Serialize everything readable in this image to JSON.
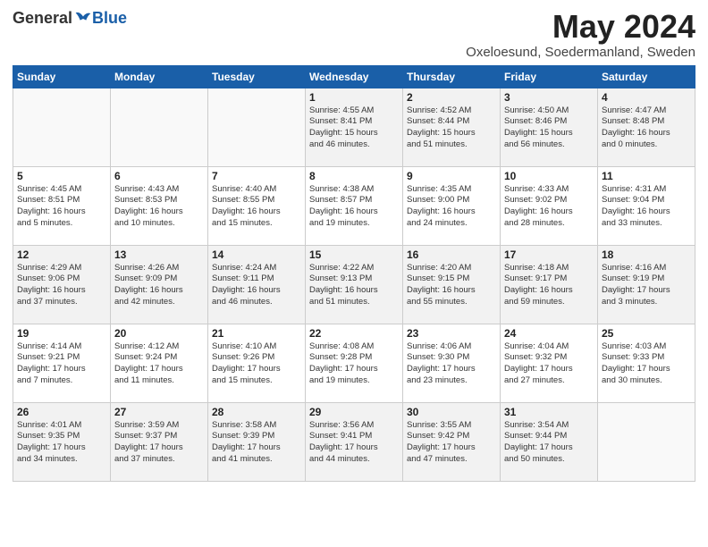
{
  "logo": {
    "general": "General",
    "blue": "Blue"
  },
  "title": "May 2024",
  "location": "Oxeloesund, Soedermanland, Sweden",
  "headers": [
    "Sunday",
    "Monday",
    "Tuesday",
    "Wednesday",
    "Thursday",
    "Friday",
    "Saturday"
  ],
  "weeks": [
    [
      {
        "num": "",
        "info": ""
      },
      {
        "num": "",
        "info": ""
      },
      {
        "num": "",
        "info": ""
      },
      {
        "num": "1",
        "info": "Sunrise: 4:55 AM\nSunset: 8:41 PM\nDaylight: 15 hours\nand 46 minutes."
      },
      {
        "num": "2",
        "info": "Sunrise: 4:52 AM\nSunset: 8:44 PM\nDaylight: 15 hours\nand 51 minutes."
      },
      {
        "num": "3",
        "info": "Sunrise: 4:50 AM\nSunset: 8:46 PM\nDaylight: 15 hours\nand 56 minutes."
      },
      {
        "num": "4",
        "info": "Sunrise: 4:47 AM\nSunset: 8:48 PM\nDaylight: 16 hours\nand 0 minutes."
      }
    ],
    [
      {
        "num": "5",
        "info": "Sunrise: 4:45 AM\nSunset: 8:51 PM\nDaylight: 16 hours\nand 5 minutes."
      },
      {
        "num": "6",
        "info": "Sunrise: 4:43 AM\nSunset: 8:53 PM\nDaylight: 16 hours\nand 10 minutes."
      },
      {
        "num": "7",
        "info": "Sunrise: 4:40 AM\nSunset: 8:55 PM\nDaylight: 16 hours\nand 15 minutes."
      },
      {
        "num": "8",
        "info": "Sunrise: 4:38 AM\nSunset: 8:57 PM\nDaylight: 16 hours\nand 19 minutes."
      },
      {
        "num": "9",
        "info": "Sunrise: 4:35 AM\nSunset: 9:00 PM\nDaylight: 16 hours\nand 24 minutes."
      },
      {
        "num": "10",
        "info": "Sunrise: 4:33 AM\nSunset: 9:02 PM\nDaylight: 16 hours\nand 28 minutes."
      },
      {
        "num": "11",
        "info": "Sunrise: 4:31 AM\nSunset: 9:04 PM\nDaylight: 16 hours\nand 33 minutes."
      }
    ],
    [
      {
        "num": "12",
        "info": "Sunrise: 4:29 AM\nSunset: 9:06 PM\nDaylight: 16 hours\nand 37 minutes."
      },
      {
        "num": "13",
        "info": "Sunrise: 4:26 AM\nSunset: 9:09 PM\nDaylight: 16 hours\nand 42 minutes."
      },
      {
        "num": "14",
        "info": "Sunrise: 4:24 AM\nSunset: 9:11 PM\nDaylight: 16 hours\nand 46 minutes."
      },
      {
        "num": "15",
        "info": "Sunrise: 4:22 AM\nSunset: 9:13 PM\nDaylight: 16 hours\nand 51 minutes."
      },
      {
        "num": "16",
        "info": "Sunrise: 4:20 AM\nSunset: 9:15 PM\nDaylight: 16 hours\nand 55 minutes."
      },
      {
        "num": "17",
        "info": "Sunrise: 4:18 AM\nSunset: 9:17 PM\nDaylight: 16 hours\nand 59 minutes."
      },
      {
        "num": "18",
        "info": "Sunrise: 4:16 AM\nSunset: 9:19 PM\nDaylight: 17 hours\nand 3 minutes."
      }
    ],
    [
      {
        "num": "19",
        "info": "Sunrise: 4:14 AM\nSunset: 9:21 PM\nDaylight: 17 hours\nand 7 minutes."
      },
      {
        "num": "20",
        "info": "Sunrise: 4:12 AM\nSunset: 9:24 PM\nDaylight: 17 hours\nand 11 minutes."
      },
      {
        "num": "21",
        "info": "Sunrise: 4:10 AM\nSunset: 9:26 PM\nDaylight: 17 hours\nand 15 minutes."
      },
      {
        "num": "22",
        "info": "Sunrise: 4:08 AM\nSunset: 9:28 PM\nDaylight: 17 hours\nand 19 minutes."
      },
      {
        "num": "23",
        "info": "Sunrise: 4:06 AM\nSunset: 9:30 PM\nDaylight: 17 hours\nand 23 minutes."
      },
      {
        "num": "24",
        "info": "Sunrise: 4:04 AM\nSunset: 9:32 PM\nDaylight: 17 hours\nand 27 minutes."
      },
      {
        "num": "25",
        "info": "Sunrise: 4:03 AM\nSunset: 9:33 PM\nDaylight: 17 hours\nand 30 minutes."
      }
    ],
    [
      {
        "num": "26",
        "info": "Sunrise: 4:01 AM\nSunset: 9:35 PM\nDaylight: 17 hours\nand 34 minutes."
      },
      {
        "num": "27",
        "info": "Sunrise: 3:59 AM\nSunset: 9:37 PM\nDaylight: 17 hours\nand 37 minutes."
      },
      {
        "num": "28",
        "info": "Sunrise: 3:58 AM\nSunset: 9:39 PM\nDaylight: 17 hours\nand 41 minutes."
      },
      {
        "num": "29",
        "info": "Sunrise: 3:56 AM\nSunset: 9:41 PM\nDaylight: 17 hours\nand 44 minutes."
      },
      {
        "num": "30",
        "info": "Sunrise: 3:55 AM\nSunset: 9:42 PM\nDaylight: 17 hours\nand 47 minutes."
      },
      {
        "num": "31",
        "info": "Sunrise: 3:54 AM\nSunset: 9:44 PM\nDaylight: 17 hours\nand 50 minutes."
      },
      {
        "num": "",
        "info": ""
      }
    ]
  ]
}
